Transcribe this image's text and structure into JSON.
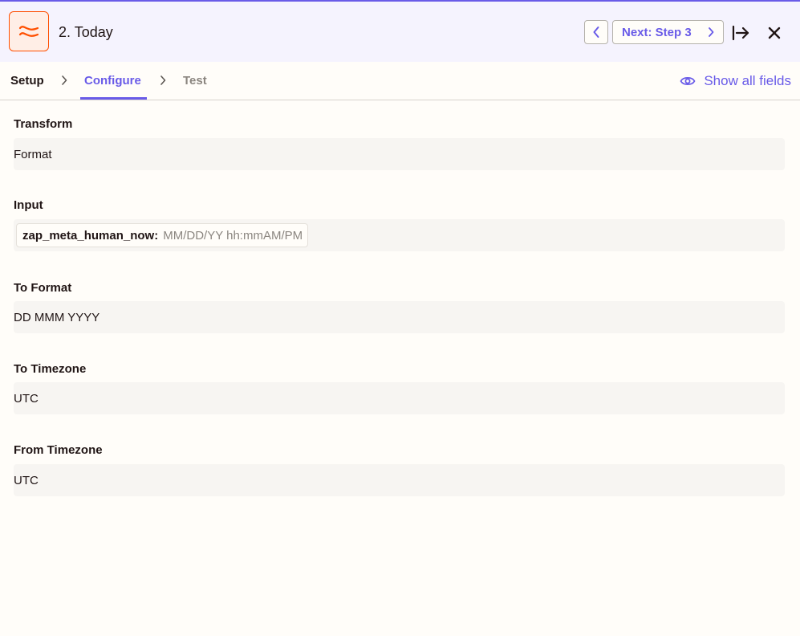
{
  "header": {
    "step_title": "2. Today",
    "next_label": "Next: Step 3",
    "app_icon": "formatter-wave-icon",
    "accent_color": "#695be8",
    "brand_color": "#ff4f00"
  },
  "tabs": [
    {
      "label": "Setup",
      "state": "completed"
    },
    {
      "label": "Configure",
      "state": "active"
    },
    {
      "label": "Test",
      "state": "disabled"
    }
  ],
  "show_all_fields_label": "Show all fields",
  "fields": {
    "transform": {
      "label": "Transform",
      "value": "Format"
    },
    "input": {
      "label": "Input",
      "pill_key": "zap_meta_human_now:",
      "pill_value": "MM/DD/YY hh:mmAM/PM"
    },
    "to_format": {
      "label": "To Format",
      "value": "DD MMM YYYY"
    },
    "to_timezone": {
      "label": "To Timezone",
      "value": "UTC"
    },
    "from_timezone": {
      "label": "From Timezone",
      "value": "UTC"
    }
  }
}
